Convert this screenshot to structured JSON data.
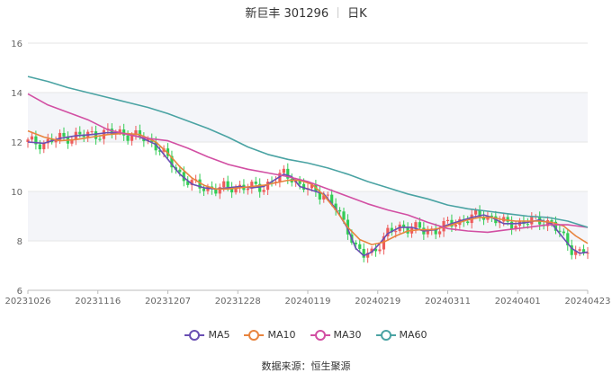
{
  "title": {
    "name": "新巨丰 301296",
    "period": "日K"
  },
  "source": "数据来源：恒生聚源",
  "colors": {
    "up": "#ee5c5c",
    "down": "#33cc55",
    "grid": "#e6e6e6",
    "band": "#f4f5f9",
    "axis": "#666666"
  },
  "chart_data": {
    "type": "candlestick",
    "x_tick_labels": [
      "20231026",
      "20231116",
      "20231207",
      "20231228",
      "20240119",
      "20240219",
      "20240311",
      "20240401",
      "20240423"
    ],
    "y_ticks": [
      6,
      8,
      10,
      12,
      14,
      16
    ],
    "ylim": [
      6,
      16
    ],
    "series": [
      {
        "name": "MA5",
        "color": "#6a4fb3",
        "values": [
          [
            0,
            12.0
          ],
          [
            4,
            11.95
          ],
          [
            8,
            12.15
          ],
          [
            12,
            12.25
          ],
          [
            16,
            12.3
          ],
          [
            20,
            12.38
          ],
          [
            24,
            12.35
          ],
          [
            28,
            12.2
          ],
          [
            32,
            11.9
          ],
          [
            35,
            11.3
          ],
          [
            38,
            10.7
          ],
          [
            41,
            10.3
          ],
          [
            44,
            10.15
          ],
          [
            47,
            10.1
          ],
          [
            50,
            10.15
          ],
          [
            53,
            10.2
          ],
          [
            56,
            10.15
          ],
          [
            59,
            10.2
          ],
          [
            62,
            10.5
          ],
          [
            64,
            10.7
          ],
          [
            66,
            10.6
          ],
          [
            68,
            10.2
          ],
          [
            71,
            10.05
          ],
          [
            74,
            9.9
          ],
          [
            77,
            9.3
          ],
          [
            80,
            8.5
          ],
          [
            82,
            7.7
          ],
          [
            84,
            7.4
          ],
          [
            86,
            7.55
          ],
          [
            88,
            7.9
          ],
          [
            90,
            8.3
          ],
          [
            93,
            8.55
          ],
          [
            96,
            8.55
          ],
          [
            99,
            8.4
          ],
          [
            102,
            8.45
          ],
          [
            105,
            8.65
          ],
          [
            108,
            8.8
          ],
          [
            111,
            8.95
          ],
          [
            114,
            9.05
          ],
          [
            116,
            8.95
          ],
          [
            119,
            8.7
          ],
          [
            122,
            8.7
          ],
          [
            125,
            8.75
          ],
          [
            128,
            8.85
          ],
          [
            131,
            8.7
          ],
          [
            134,
            8.1
          ],
          [
            136,
            7.7
          ],
          [
            138,
            7.5
          ],
          [
            140,
            7.55
          ]
        ]
      },
      {
        "name": "MA10",
        "color": "#e8843e",
        "values": [
          [
            0,
            12.45
          ],
          [
            4,
            12.2
          ],
          [
            8,
            12.05
          ],
          [
            12,
            12.1
          ],
          [
            16,
            12.2
          ],
          [
            20,
            12.3
          ],
          [
            24,
            12.35
          ],
          [
            28,
            12.3
          ],
          [
            32,
            12.0
          ],
          [
            35,
            11.55
          ],
          [
            38,
            11.0
          ],
          [
            41,
            10.55
          ],
          [
            44,
            10.25
          ],
          [
            47,
            10.1
          ],
          [
            50,
            10.1
          ],
          [
            53,
            10.15
          ],
          [
            56,
            10.2
          ],
          [
            59,
            10.25
          ],
          [
            62,
            10.35
          ],
          [
            65,
            10.45
          ],
          [
            68,
            10.45
          ],
          [
            71,
            10.3
          ],
          [
            74,
            9.85
          ],
          [
            77,
            9.25
          ],
          [
            80,
            8.55
          ],
          [
            83,
            8.05
          ],
          [
            86,
            7.85
          ],
          [
            89,
            7.95
          ],
          [
            92,
            8.2
          ],
          [
            95,
            8.4
          ],
          [
            98,
            8.45
          ],
          [
            101,
            8.45
          ],
          [
            104,
            8.55
          ],
          [
            107,
            8.7
          ],
          [
            110,
            8.85
          ],
          [
            113,
            8.95
          ],
          [
            116,
            8.95
          ],
          [
            119,
            8.85
          ],
          [
            122,
            8.8
          ],
          [
            125,
            8.8
          ],
          [
            128,
            8.8
          ],
          [
            131,
            8.75
          ],
          [
            134,
            8.6
          ],
          [
            137,
            8.2
          ],
          [
            140,
            7.9
          ]
        ]
      },
      {
        "name": "MA30",
        "color": "#d24fa3",
        "values": [
          [
            0,
            13.95
          ],
          [
            5,
            13.5
          ],
          [
            10,
            13.2
          ],
          [
            15,
            12.9
          ],
          [
            20,
            12.5
          ],
          [
            25,
            12.3
          ],
          [
            30,
            12.15
          ],
          [
            35,
            12.05
          ],
          [
            40,
            11.75
          ],
          [
            45,
            11.4
          ],
          [
            50,
            11.1
          ],
          [
            55,
            10.9
          ],
          [
            60,
            10.75
          ],
          [
            65,
            10.6
          ],
          [
            70,
            10.4
          ],
          [
            75,
            10.1
          ],
          [
            80,
            9.8
          ],
          [
            85,
            9.5
          ],
          [
            90,
            9.25
          ],
          [
            95,
            9.05
          ],
          [
            100,
            8.75
          ],
          [
            105,
            8.5
          ],
          [
            110,
            8.4
          ],
          [
            115,
            8.35
          ],
          [
            120,
            8.45
          ],
          [
            125,
            8.55
          ],
          [
            130,
            8.65
          ],
          [
            135,
            8.65
          ],
          [
            140,
            8.55
          ]
        ]
      },
      {
        "name": "MA60",
        "color": "#4aa3a3",
        "values": [
          [
            0,
            14.65
          ],
          [
            5,
            14.45
          ],
          [
            10,
            14.2
          ],
          [
            15,
            14.0
          ],
          [
            20,
            13.8
          ],
          [
            25,
            13.6
          ],
          [
            30,
            13.4
          ],
          [
            35,
            13.15
          ],
          [
            40,
            12.85
          ],
          [
            45,
            12.55
          ],
          [
            50,
            12.2
          ],
          [
            55,
            11.8
          ],
          [
            60,
            11.5
          ],
          [
            65,
            11.3
          ],
          [
            70,
            11.15
          ],
          [
            75,
            10.95
          ],
          [
            80,
            10.7
          ],
          [
            85,
            10.4
          ],
          [
            90,
            10.15
          ],
          [
            95,
            9.9
          ],
          [
            100,
            9.7
          ],
          [
            105,
            9.45
          ],
          [
            110,
            9.3
          ],
          [
            115,
            9.2
          ],
          [
            120,
            9.1
          ],
          [
            125,
            9.0
          ],
          [
            130,
            8.95
          ],
          [
            135,
            8.8
          ],
          [
            140,
            8.55
          ]
        ]
      }
    ],
    "legend_position": "bottom",
    "grid": true
  }
}
